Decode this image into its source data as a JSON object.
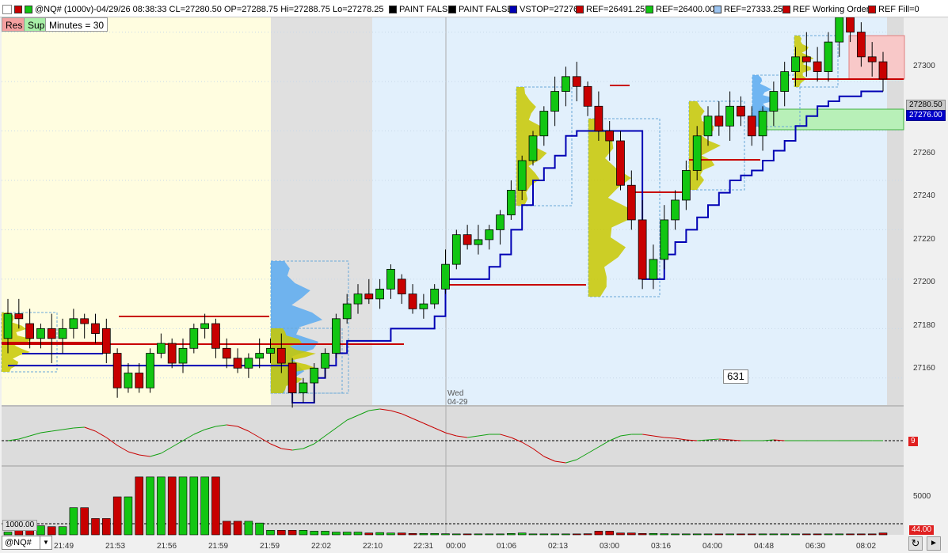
{
  "header": {
    "symbol_info": "@NQ# (1000v)-04/29/26 08:38:33 CL=27280.50 OP=27288.75 Hi=27288.75 Lo=27278.25",
    "paint_false_1": "PAINT FALSE",
    "paint_false_2": "PAINT FALSE",
    "vstop": "VSTOP=27276",
    "ref1": "REF=26491.25",
    "ref2": "REF=26400.00",
    "ref3": "REF=27333.25",
    "ref_working": "REF Working Orders",
    "ref_fill": "REF Fill=0"
  },
  "toolbar": {
    "res_label": "Res",
    "sup_label": "Sup",
    "minutes_label": "Minutes = 30"
  },
  "price_axis": {
    "ticks": [
      "27300",
      "27280",
      "27260",
      "27240",
      "27220",
      "27200",
      "27180",
      "27160"
    ],
    "last_price": "27280.50",
    "vstop_price": "27276.00"
  },
  "date_marker": {
    "day": "Wed",
    "date": "04-29"
  },
  "counter_value": "631",
  "oscillator": {
    "value_tag": "9"
  },
  "volume": {
    "axis_tick": "5000",
    "left_tag": "1000.00",
    "right_tag": "44.00"
  },
  "time_axis": [
    "21:49",
    "21:53",
    "21:56",
    "21:59",
    "21:59",
    "22:02",
    "22:10",
    "22:31",
    "00:00",
    "01:06",
    "02:13",
    "03:00",
    "03:16",
    "04:00",
    "04:48",
    "06:30",
    "08:02"
  ],
  "symbol_selector": {
    "value": "@NQ#"
  },
  "colors": {
    "up": "#12c612",
    "down": "#c80000",
    "vstop": "#0000b4",
    "profile_yellow": "#c8c800",
    "profile_blue": "#5aaaf0",
    "bg_yellow": "#fffde0",
    "bg_gray": "#e0e0e0",
    "bg_blue": "#e2f0fc"
  },
  "chart_data": {
    "type": "candlestick",
    "ylim": [
      27150,
      27305
    ],
    "candles": [
      [
        27176,
        27192,
        27170,
        27186
      ],
      [
        27186,
        27192,
        27180,
        27184
      ],
      [
        27182,
        27188,
        27172,
        27176
      ],
      [
        27176,
        27182,
        27172,
        27180
      ],
      [
        27180,
        27186,
        27166,
        27176
      ],
      [
        27176,
        27184,
        27170,
        27180
      ],
      [
        27180,
        27188,
        27176,
        27184
      ],
      [
        27184,
        27186,
        27176,
        27182
      ],
      [
        27182,
        27186,
        27174,
        27178
      ],
      [
        27180,
        27184,
        27166,
        27170
      ],
      [
        27170,
        27172,
        27152,
        27156
      ],
      [
        27156,
        27166,
        27154,
        27162
      ],
      [
        27162,
        27166,
        27154,
        27156
      ],
      [
        27156,
        27172,
        27154,
        27170
      ],
      [
        27170,
        27178,
        27168,
        27174
      ],
      [
        27174,
        27176,
        27164,
        27166
      ],
      [
        27166,
        27176,
        27162,
        27172
      ],
      [
        27172,
        27182,
        27170,
        27180
      ],
      [
        27180,
        27186,
        27176,
        27182
      ],
      [
        27182,
        27184,
        27168,
        27172
      ],
      [
        27172,
        27176,
        27164,
        27168
      ],
      [
        27168,
        27172,
        27162,
        27164
      ],
      [
        27164,
        27170,
        27160,
        27168
      ],
      [
        27168,
        27176,
        27164,
        27170
      ],
      [
        27170,
        27176,
        27166,
        27172
      ],
      [
        27172,
        27178,
        27162,
        27166
      ],
      [
        27166,
        27168,
        27148,
        27154
      ],
      [
        27154,
        27160,
        27150,
        27158
      ],
      [
        27158,
        27166,
        27150,
        27164
      ],
      [
        27164,
        27172,
        27160,
        27170
      ],
      [
        27170,
        27186,
        27168,
        27184
      ],
      [
        27184,
        27194,
        27182,
        27190
      ],
      [
        27190,
        27198,
        27186,
        27194
      ],
      [
        27194,
        27200,
        27190,
        27192
      ],
      [
        27192,
        27200,
        27188,
        27196
      ],
      [
        27196,
        27206,
        27192,
        27204
      ],
      [
        27200,
        27202,
        27190,
        27194
      ],
      [
        27194,
        27198,
        27186,
        27188
      ],
      [
        27188,
        27194,
        27184,
        27190
      ],
      [
        27190,
        27198,
        27188,
        27196
      ],
      [
        27196,
        27212,
        27194,
        27206
      ],
      [
        27206,
        27220,
        27204,
        27218
      ],
      [
        27218,
        27222,
        27212,
        27214
      ],
      [
        27214,
        27222,
        27210,
        27216
      ],
      [
        27216,
        27222,
        27212,
        27220
      ],
      [
        27220,
        27228,
        27214,
        27226
      ],
      [
        27226,
        27240,
        27224,
        27236
      ],
      [
        27236,
        27250,
        27232,
        27248
      ],
      [
        27248,
        27260,
        27246,
        27258
      ],
      [
        27258,
        27270,
        27254,
        27268
      ],
      [
        27268,
        27282,
        27262,
        27276
      ],
      [
        27276,
        27286,
        27270,
        27282
      ],
      [
        27282,
        27288,
        27272,
        27278
      ],
      [
        27278,
        27280,
        27266,
        27270
      ],
      [
        27270,
        27276,
        27256,
        27260
      ],
      [
        27260,
        27264,
        27248,
        27256
      ],
      [
        27256,
        27260,
        27236,
        27238
      ],
      [
        27238,
        27244,
        27220,
        27224
      ],
      [
        27224,
        27232,
        27196,
        27200
      ],
      [
        27200,
        27214,
        27196,
        27208
      ],
      [
        27208,
        27230,
        27204,
        27224
      ],
      [
        27224,
        27236,
        27220,
        27232
      ],
      [
        27232,
        27248,
        27228,
        27244
      ],
      [
        27244,
        27262,
        27240,
        27258
      ],
      [
        27258,
        27270,
        27254,
        27266
      ],
      [
        27266,
        27272,
        27258,
        27262
      ],
      [
        27262,
        27276,
        27256,
        27270
      ],
      [
        27270,
        27274,
        27262,
        27266
      ],
      [
        27266,
        27270,
        27254,
        27258
      ],
      [
        27258,
        27270,
        27252,
        27268
      ],
      [
        27268,
        27280,
        27262,
        27276
      ],
      [
        27276,
        27288,
        27270,
        27284
      ],
      [
        27284,
        27294,
        27278,
        27290
      ],
      [
        27290,
        27300,
        27282,
        27288
      ],
      [
        27288,
        27294,
        27280,
        27284
      ],
      [
        27284,
        27300,
        27280,
        27296
      ],
      [
        27296,
        27312,
        27290,
        27306
      ],
      [
        27306,
        27314,
        27296,
        27300
      ],
      [
        27300,
        27304,
        27286,
        27290
      ],
      [
        27290,
        27296,
        27282,
        27288
      ],
      [
        27288,
        27292,
        27276,
        27281
      ]
    ],
    "vstop": [
      27165,
      27165,
      27165,
      27165,
      27165,
      27165,
      27165,
      27165,
      27165,
      27165,
      27165,
      27165,
      27165,
      27165,
      27165,
      27165,
      27165,
      27165,
      27165,
      27165,
      27165,
      27165,
      27165,
      27165,
      27165,
      27165,
      27150,
      27150,
      27160,
      27165,
      27170,
      27175,
      27175,
      27175,
      27175,
      27180,
      27180,
      27180,
      27180,
      27185,
      27200,
      27200,
      27200,
      27200,
      27205,
      27210,
      27220,
      27230,
      27240,
      27245,
      27250,
      27258,
      27260,
      27260,
      27260,
      27260,
      27260,
      27260,
      27200,
      27200,
      27210,
      27215,
      27220,
      27225,
      27230,
      27235,
      27240,
      27242,
      27244,
      27248,
      27252,
      27256,
      27262,
      27266,
      27270,
      27272,
      27274,
      27274,
      27276,
      27276,
      27276
    ],
    "oscillator": [
      0,
      0.1,
      0.3,
      0.5,
      0.6,
      0.7,
      0.8,
      0.85,
      0.6,
      0.2,
      -0.3,
      -0.7,
      -0.9,
      -1,
      -0.8,
      -0.4,
      0,
      0.4,
      0.7,
      0.9,
      1,
      0.9,
      0.6,
      0.2,
      -0.2,
      -0.5,
      -0.6,
      -0.5,
      -0.2,
      0.3,
      0.8,
      1.3,
      1.6,
      1.9,
      2,
      1.9,
      1.7,
      1.4,
      1.1,
      0.8,
      0.5,
      0.3,
      0.2,
      0.3,
      0.4,
      0.4,
      0.2,
      -0.1,
      -0.5,
      -1,
      -1.3,
      -1.4,
      -1.2,
      -0.8,
      -0.4,
      0,
      0.3,
      0.4,
      0.4,
      0.3,
      0.2,
      0.15,
      0.05,
      0,
      0.05,
      0.1,
      0.05,
      0,
      0,
      0,
      0.05,
      0,
      0,
      0,
      0,
      0,
      0,
      0,
      0,
      0,
      0
    ],
    "volume": [
      300,
      500,
      1000,
      1000,
      900,
      900,
      3000,
      3000,
      1800,
      1800,
      4200,
      4200,
      6400,
      6400,
      6400,
      6400,
      6400,
      6400,
      6400,
      6400,
      1500,
      1500,
      1500,
      1300,
      500,
      500,
      500,
      500,
      400,
      400,
      300,
      300,
      300,
      200,
      250,
      200,
      200,
      150,
      150,
      150,
      120,
      100,
      100,
      100,
      100,
      100,
      150,
      200,
      100,
      100,
      100,
      100,
      100,
      120,
      400,
      400,
      200,
      200,
      150,
      150,
      120,
      100,
      100,
      100,
      100,
      100,
      100,
      100,
      100,
      100,
      100,
      100,
      100,
      100,
      100,
      100,
      100,
      100,
      100,
      100,
      200
    ],
    "volume_ylim": [
      0,
      7000
    ]
  }
}
